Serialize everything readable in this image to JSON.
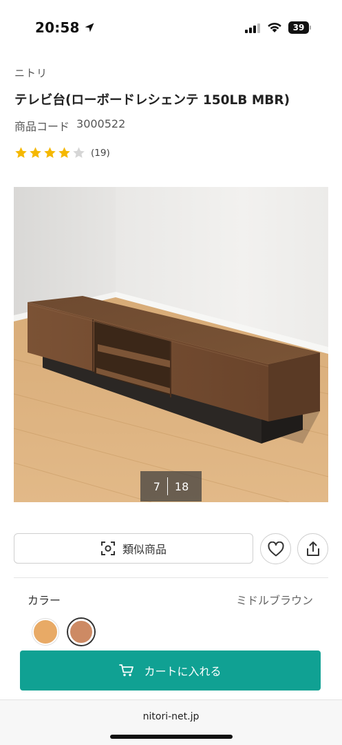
{
  "status_bar": {
    "time": "20:58",
    "battery": "39"
  },
  "product": {
    "brand": "ニトリ",
    "title": "テレビ台(ローボードレシェンテ 150LB MBR)",
    "code_label": "商品コード",
    "code_value": "3000522",
    "rating": 4,
    "rating_max": 5,
    "review_count": "(19)"
  },
  "gallery": {
    "current": "7",
    "total": "18"
  },
  "actions": {
    "similar_label": "類似商品"
  },
  "color": {
    "label": "カラー",
    "selected": "ミドルブラウン",
    "swatches": [
      "#e8aa66",
      "#cd8a64"
    ]
  },
  "cart": {
    "label": "カートに入れる",
    "color": "#10a193"
  },
  "browser": {
    "url": "nitori-net.jp"
  }
}
